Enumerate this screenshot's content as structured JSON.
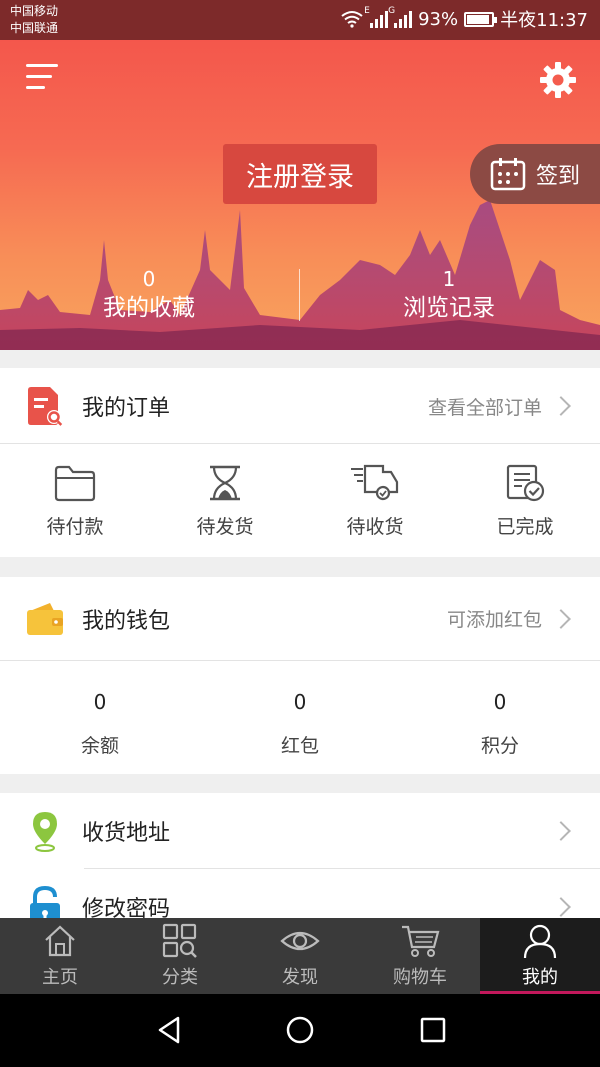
{
  "status_bar": {
    "carrier1": "中国移动",
    "carrier2": "中国联通",
    "signal1_type": "E",
    "signal2_type": "G",
    "battery": "93%",
    "time": "半夜11:37"
  },
  "header": {
    "menu_icon": "menu-icon",
    "settings_icon": "gear-icon",
    "register_label": "注册登录",
    "checkin_label": "签到",
    "favorites_count": "0",
    "favorites_label": "我的收藏",
    "history_count": "1",
    "history_label": "浏览记录"
  },
  "orders": {
    "title": "我的订单",
    "view_all": "查看全部订单",
    "items": [
      {
        "label": "待付款",
        "icon": "folder-icon"
      },
      {
        "label": "待发货",
        "icon": "hourglass-icon"
      },
      {
        "label": "待收货",
        "icon": "delivery-truck-icon"
      },
      {
        "label": "已完成",
        "icon": "completed-doc-icon"
      }
    ]
  },
  "wallet": {
    "title": "我的钱包",
    "action": "可添加红包",
    "items": [
      {
        "value": "0",
        "label": "余额"
      },
      {
        "value": "0",
        "label": "红包"
      },
      {
        "value": "0",
        "label": "积分"
      }
    ]
  },
  "settings": [
    {
      "label": "收货地址",
      "icon": "location-pin-icon"
    },
    {
      "label": "修改密码",
      "icon": "lock-icon"
    }
  ],
  "tabbar": [
    {
      "label": "主页",
      "icon": "home-icon"
    },
    {
      "label": "分类",
      "icon": "category-icon"
    },
    {
      "label": "发现",
      "icon": "eye-icon"
    },
    {
      "label": "购物车",
      "icon": "cart-icon"
    },
    {
      "label": "我的",
      "icon": "user-icon",
      "active": true
    }
  ],
  "colors": {
    "header_top": "#f4574c",
    "header_bottom": "#f9a45e",
    "register_bg": "#d7483f",
    "tab_active_underline": "#c2185b"
  }
}
